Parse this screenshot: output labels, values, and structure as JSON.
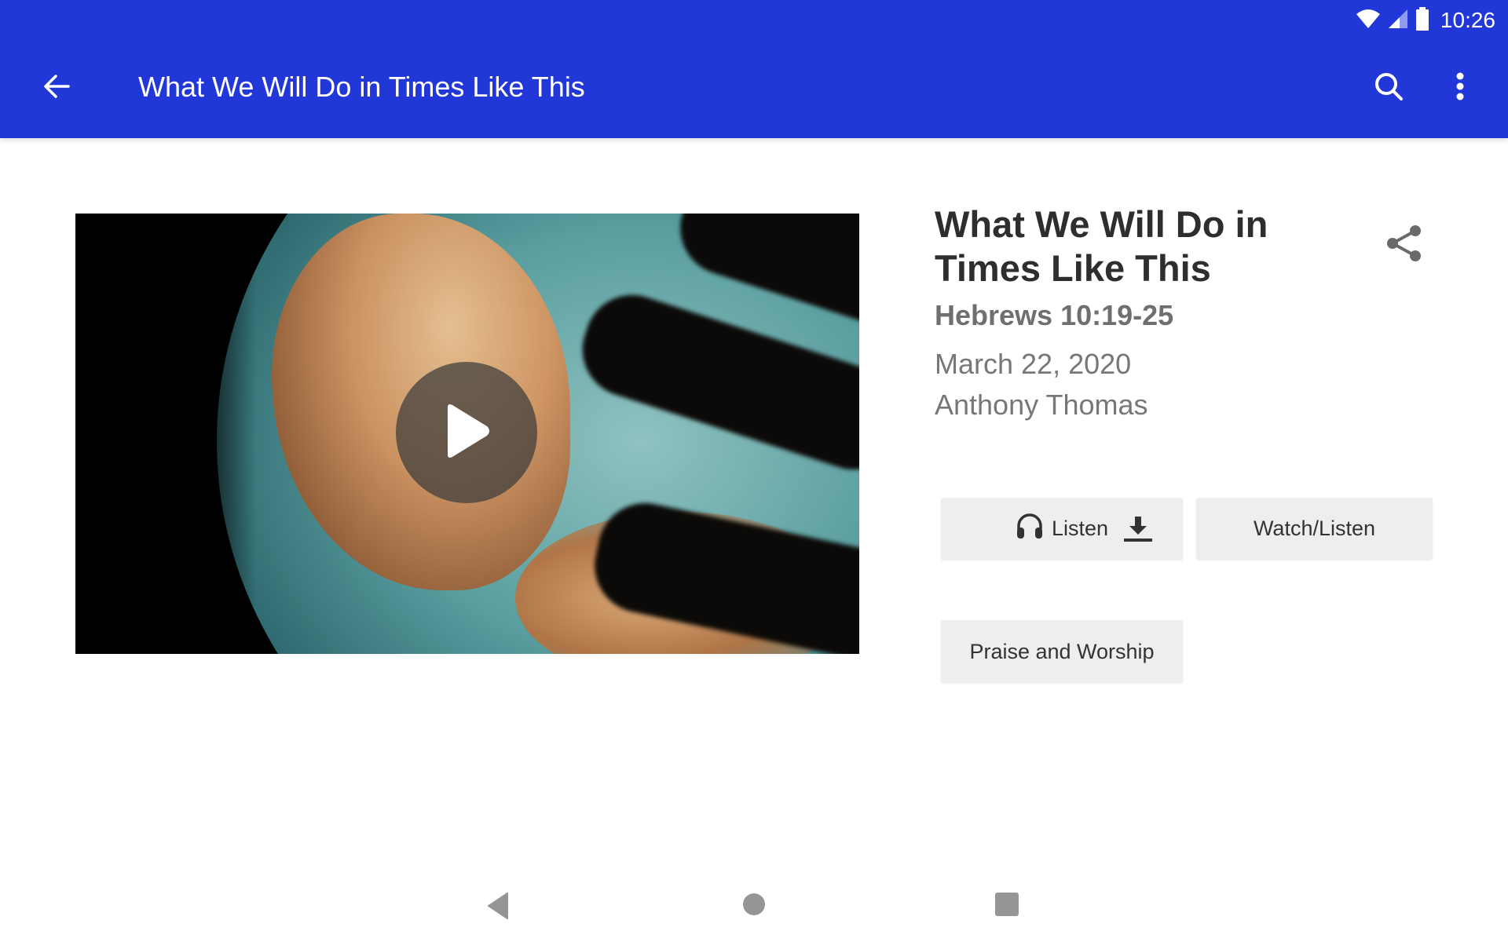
{
  "status_bar": {
    "time": "10:26",
    "icons": [
      "wifi-icon",
      "cell-signal-icon",
      "battery-icon"
    ]
  },
  "app_bar": {
    "title": "What We Will Do in Times Like This",
    "back_icon": "arrow-left-icon",
    "actions": [
      "search-icon",
      "more-vert-icon"
    ],
    "color": "#2237d8"
  },
  "media": {
    "thumbnail_desc": "Illuminated globe with fingers touching the Caribbean",
    "play_icon": "play-icon"
  },
  "sermon": {
    "title": "What We Will Do in Times Like This",
    "scripture": "Hebrews 10:19-25",
    "date": "March 22, 2020",
    "speaker": "Anthony Thomas",
    "share_icon": "share-icon"
  },
  "buttons": {
    "listen": "Listen",
    "watch_listen": "Watch/Listen",
    "series": "Praise and Worship"
  },
  "nav_bar": {
    "icons": [
      "nav-back-icon",
      "nav-home-icon",
      "nav-recents-icon"
    ]
  }
}
